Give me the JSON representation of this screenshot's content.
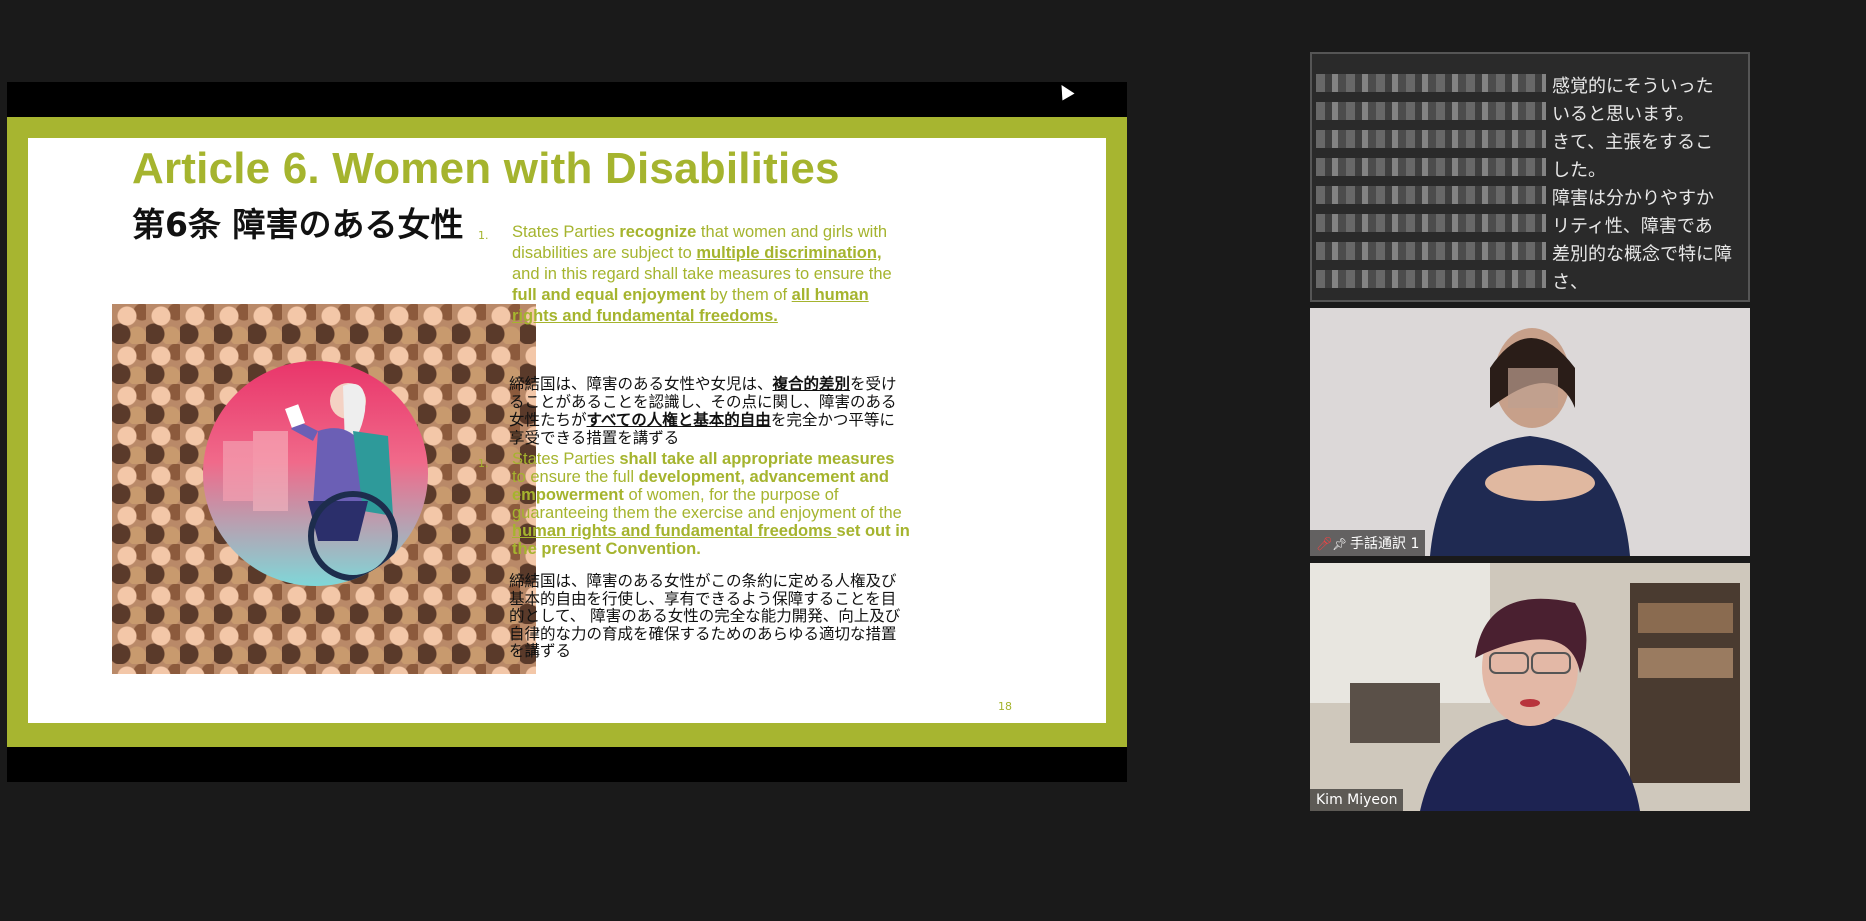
{
  "slide": {
    "title_en": "Article 6. Women with Disabilities",
    "title_ja": "第6条  障害のある女性",
    "item1": {
      "num": "1.",
      "p1": "States Parties ",
      "b1": "recognize",
      "p2": " that women and girls with disabilities are subject to ",
      "u1": "multiple discrimination,",
      "p3": " and in this regard shall take measures to ensure the ",
      "b2": "full and equal enjoyment",
      "p4": " by them of ",
      "u2": "all human rights and fundamental freedoms."
    },
    "item1_ja": {
      "p1": "締結国は、障害のある女性や女児は、",
      "u1": "複合的差別",
      "p2": "を受けることがあることを認識し、その点に関し、障害のある女性たちが",
      "u2": "すべての人権と基本的自由",
      "p3": "を完全かつ平等に享受できる措置を講ずる"
    },
    "item2": {
      "num": "1.",
      "p1": "States Parties ",
      "b1": "shall take all appropriate measures",
      "p2": " to ensure the full ",
      "b2": "development, advancement and empowerment",
      "p3": " of women, for the purpose of guaranteeing them the exercise and enjoyment of the ",
      "u1": "human rights and fundamental freedoms ",
      "b3": "set out in the present Convention."
    },
    "item2_ja": "締結国は、障害のある女性がこの条約に定める人権及び基本的自由を行使し、享有できるよう保障することを目的として、 障害のある女性の完全な能力開発、向上及び自律的な力の育成を確保するためのあらゆる適切な措置を講ずる",
    "page_number": "18"
  },
  "captions": [
    "感覚的にそういった",
    "いると思います。",
    "きて、主張をするこ",
    "した。",
    "障害は分かりやすか",
    "リティ性、障害であ",
    "差別的な概念で特に障",
    "さ、"
  ],
  "participants": {
    "interpreter_name": "手話通訳 1",
    "speaker_name": "Kim Miyeon"
  },
  "icons": {
    "mute": "mic-muted-icon",
    "pin": "pin-icon"
  }
}
